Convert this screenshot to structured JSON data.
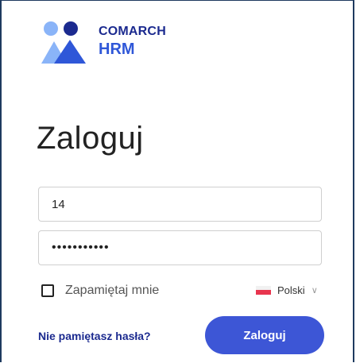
{
  "brand": {
    "name_top": "COMARCH",
    "name_bottom": "HRM",
    "logo_icon": "two-people-icon",
    "colors": {
      "navy": "#1b2a8f",
      "blue": "#2f57d8",
      "light_blue": "#8ab4f8",
      "button": "#3d56d6"
    }
  },
  "page": {
    "title": "Zaloguj"
  },
  "form": {
    "username_value": "14",
    "password_value": "•••••••••••",
    "remember_label": "Zapamiętaj mnie",
    "remember_checked": false,
    "forgot_label": "Nie pamiętasz hasła?",
    "submit_label": "Zaloguj"
  },
  "language": {
    "selected": "Polski",
    "flag_icon": "poland-flag-icon",
    "chevron_icon": "chevron-down-icon"
  }
}
